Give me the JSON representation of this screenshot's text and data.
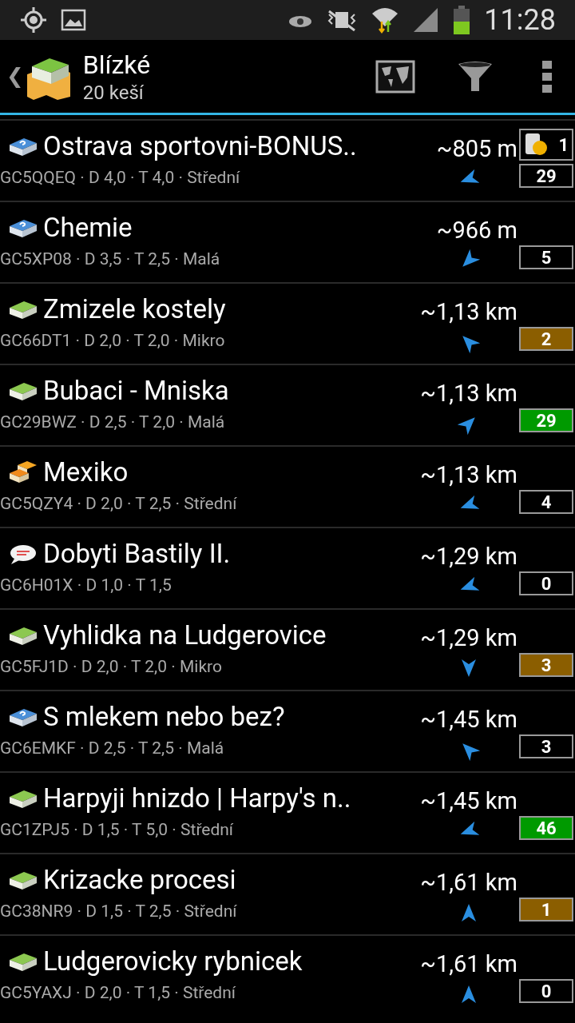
{
  "status_bar": {
    "time": "11:28"
  },
  "action_bar": {
    "title": "Blízké",
    "subtitle": "20 keší",
    "back": "❮"
  },
  "caches": [
    {
      "kind": "mystery",
      "name": "Ostrava sportovni-BONUS..",
      "info": "GC5QQEQ · D 4,0 · T 4,0 · Střední",
      "distance": "~805 m",
      "arrow": {
        "kind": "w"
      },
      "finds": {
        "count": "29"
      },
      "extra": "1"
    },
    {
      "kind": "mystery",
      "name": "Chemie",
      "info": "GC5XP08 · D 3,5 · T 2,5 · Malá",
      "distance": "~966 m",
      "arrow": {
        "kind": "sw"
      },
      "finds": {
        "count": "5"
      }
    },
    {
      "kind": "traditional",
      "name": "Zmizele kostely",
      "info": "GC66DT1 · D 2,0 · T 2,0 · Mikro",
      "distance": "~1,13 km",
      "arrow": {
        "kind": "nw"
      },
      "finds": {
        "count": "2",
        "color": "#8b5e00"
      }
    },
    {
      "kind": "traditional",
      "name": "Bubaci - Mniska",
      "info": "GC29BWZ · D 2,5 · T 2,0 · Malá",
      "distance": "~1,13 km",
      "arrow": {
        "kind": "ne"
      },
      "finds": {
        "count": "29",
        "color": "#009a00"
      }
    },
    {
      "kind": "multi",
      "name": "Mexiko",
      "info": "GC5QZY4 · D 2,0 · T 2,5 · Střední",
      "distance": "~1,13 km",
      "arrow": {
        "kind": "w"
      },
      "finds": {
        "count": "4"
      }
    },
    {
      "kind": "event",
      "name": "Dobyti Bastily II.",
      "info": "GC6H01X · D 1,0 · T 1,5",
      "distance": "~1,29 km",
      "arrow": {
        "kind": "w"
      },
      "finds": {
        "count": "0"
      }
    },
    {
      "kind": "traditional",
      "name": "Vyhlidka na Ludgerovice",
      "info": "GC5FJ1D · D 2,0 · T 2,0 · Mikro",
      "distance": "~1,29 km",
      "arrow": {
        "kind": "s"
      },
      "finds": {
        "count": "3",
        "color": "#8b5e00"
      }
    },
    {
      "kind": "mystery",
      "name": "S mlekem nebo bez?",
      "info": "GC6EMKF · D 2,5 · T 2,5 · Malá",
      "distance": "~1,45 km",
      "arrow": {
        "kind": "nw"
      },
      "finds": {
        "count": "3"
      }
    },
    {
      "kind": "traditional",
      "name": "Harpyji hnizdo | Harpy's n..",
      "info": "GC1ZPJ5 · D 1,5 · T 5,0 · Střední",
      "distance": "~1,45 km",
      "arrow": {
        "kind": "w"
      },
      "finds": {
        "count": "46",
        "color": "#009a00"
      }
    },
    {
      "kind": "traditional",
      "name": "Krizacke procesi",
      "info": "GC38NR9 · D 1,5 · T 2,5 · Střední",
      "distance": "~1,61 km",
      "arrow": {
        "kind": "n"
      },
      "finds": {
        "count": "1",
        "color": "#8b5e00"
      }
    },
    {
      "kind": "traditional",
      "name": "Ludgerovicky rybnicek",
      "info": "GC5YAXJ · D 2,0 · T 1,5 · Střední",
      "distance": "~1,61 km",
      "arrow": {
        "kind": "n"
      },
      "finds": {
        "count": "0"
      }
    }
  ]
}
